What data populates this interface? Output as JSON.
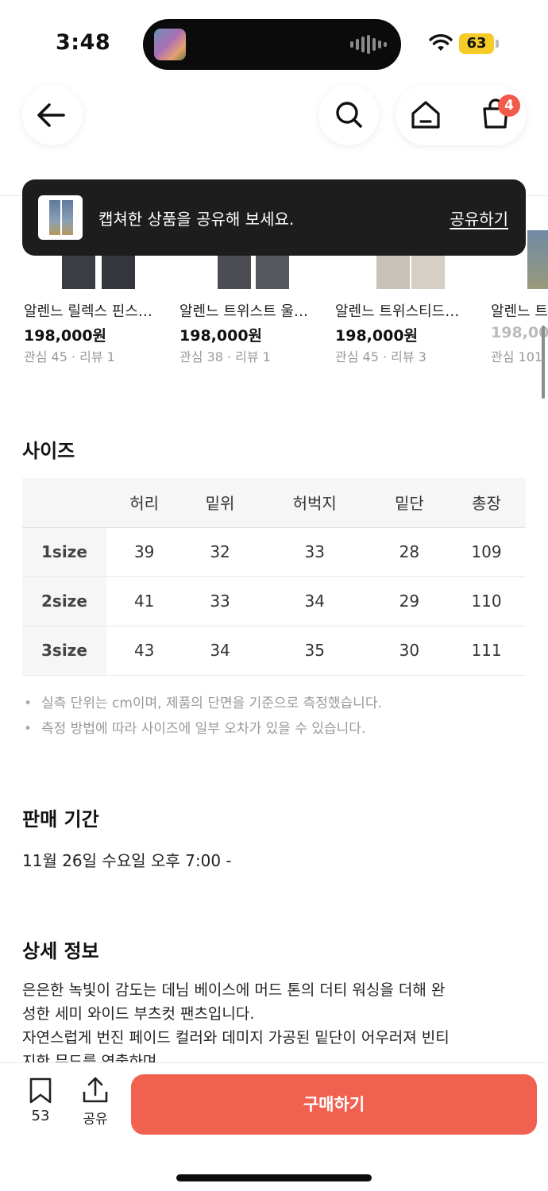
{
  "status_bar": {
    "time": "3:48",
    "battery": "63"
  },
  "nav": {
    "cart_count": "4"
  },
  "toast": {
    "message": "캡쳐한 상품을 공유해 보세요.",
    "action": "공유하기"
  },
  "related_products": [
    {
      "name": "알렌느 릴렉스 핀스…",
      "price": "198,000원",
      "meta": "관심 45 · 리뷰 1"
    },
    {
      "name": "알렌느 트위스트 울…",
      "price": "198,000원",
      "meta": "관심 38 · 리뷰 1"
    },
    {
      "name": "알렌느 트위스티드…",
      "price": "198,000원",
      "meta": "관심 45 · 리뷰 3"
    },
    {
      "name": "알렌느 트",
      "price": "198,00",
      "meta": "관심 101"
    }
  ],
  "size": {
    "title": "사이즈",
    "headers": [
      "",
      "허리",
      "밑위",
      "허벅지",
      "밑단",
      "총장"
    ],
    "rows": [
      {
        "label": "1size",
        "values": [
          "39",
          "32",
          "33",
          "28",
          "109"
        ]
      },
      {
        "label": "2size",
        "values": [
          "41",
          "33",
          "34",
          "29",
          "110"
        ]
      },
      {
        "label": "3size",
        "values": [
          "43",
          "34",
          "35",
          "30",
          "111"
        ]
      }
    ],
    "notes": [
      "실측 단위는 cm이며, 제품의 단면을 기준으로 측정했습니다.",
      "측정 방법에 따라 사이즈에 일부 오차가 있을 수 있습니다."
    ]
  },
  "sale_period": {
    "title": "판매 기간",
    "text": "11월 26일 수요일 오후 7:00 -"
  },
  "details": {
    "title": "상세 정보",
    "lines": [
      "은은한 녹빛이 감도는 데님 베이스에 머드 톤의 더티 워싱을 더해 완",
      "성한 세미 와이드 부츠컷 팬츠입니다.",
      "자연스럽게 번진 페이드 컬러와 데미지 가공된 밑단이 어우러져 빈티",
      "지한 무드를 연출하며"
    ]
  },
  "bottom_bar": {
    "bookmark_count": "53",
    "share_label": "공유",
    "buy_label": "구매하기"
  },
  "colors": {
    "accent": "#f06150",
    "badge": "#f25b4a",
    "toast_bg": "#1d1d1d"
  }
}
